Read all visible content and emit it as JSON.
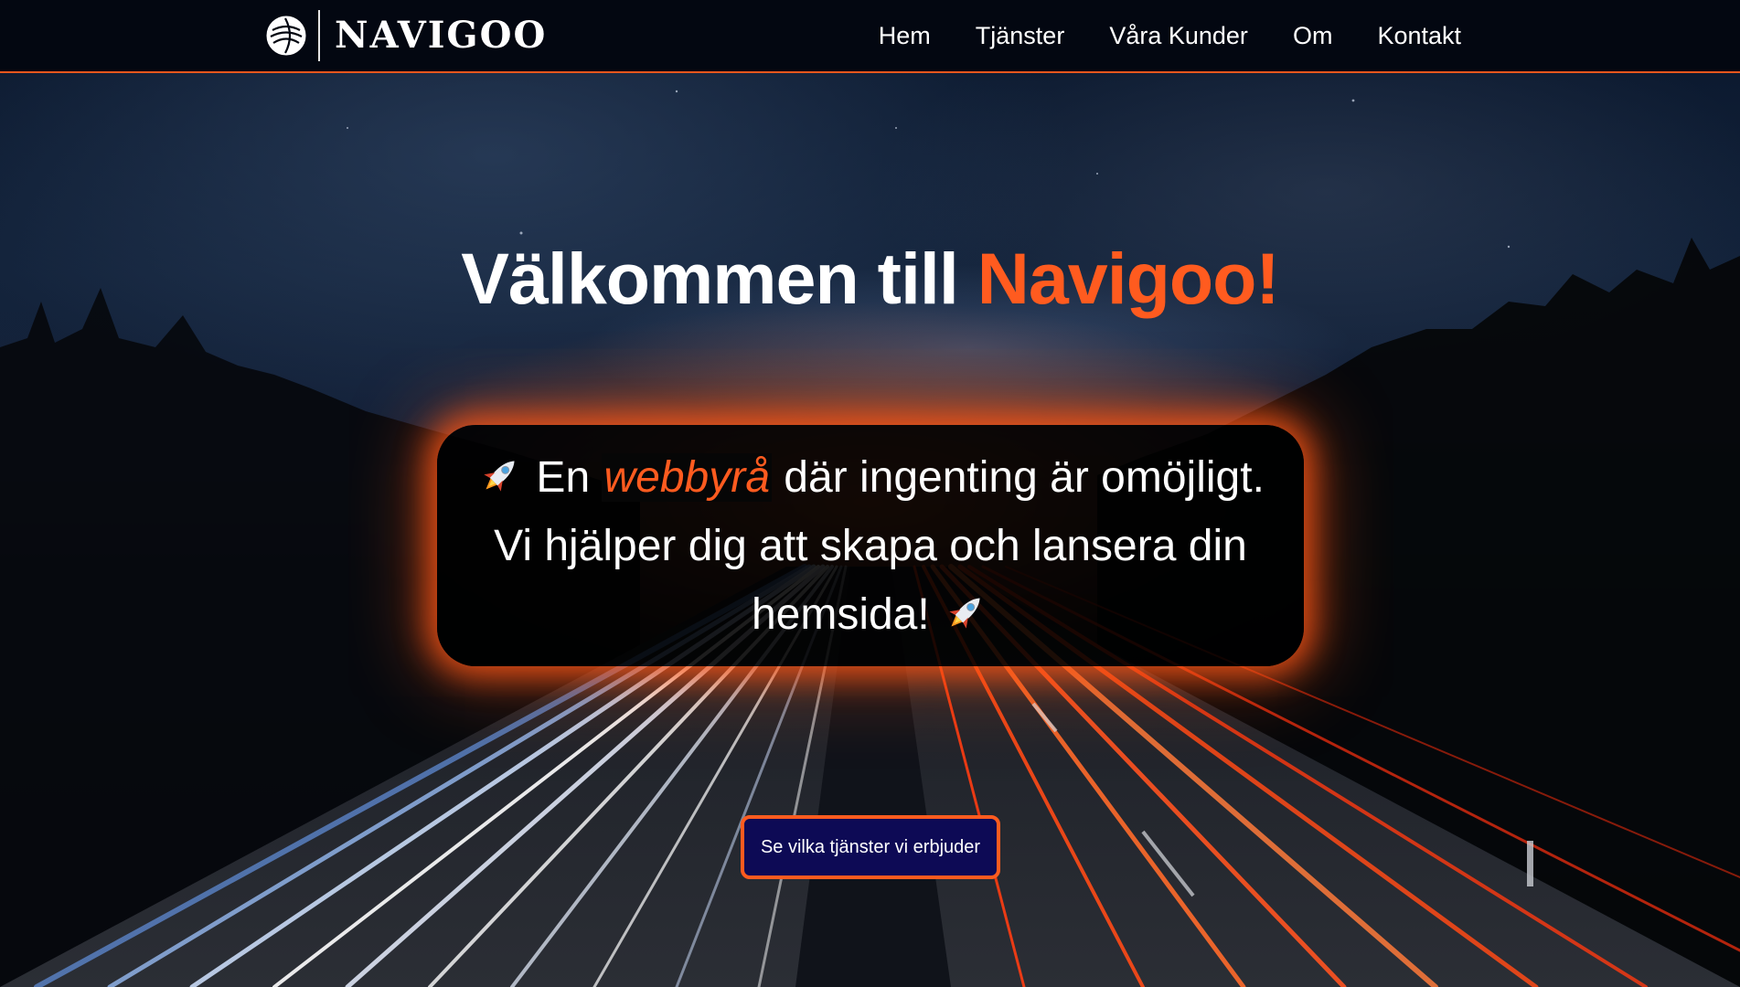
{
  "header": {
    "logo_text": "NAVIGOO",
    "nav": [
      {
        "label": "Hem"
      },
      {
        "label": "Tjänster"
      },
      {
        "label": "Våra Kunder"
      },
      {
        "label": "Om"
      },
      {
        "label": "Kontakt"
      }
    ]
  },
  "hero": {
    "headline_prefix": "Välkommen till",
    "headline_accent": "Navigoo!",
    "tagline": {
      "part1": "En",
      "highlight": "webbyrå",
      "part2": "där ingenting är omöjligt.",
      "line2": "Vi hjälper dig att skapa och lansera din",
      "line3": "hemsida!"
    },
    "cta_label": "Se vilka tjänster vi erbjuder"
  },
  "icons": {
    "logo": "globe-icon",
    "decoration": "rocket-icon"
  },
  "colors": {
    "accent": "#ff5b1f",
    "header_bg": "#030711",
    "cta_bg": "#0d0a55",
    "text": "#ffffff"
  }
}
